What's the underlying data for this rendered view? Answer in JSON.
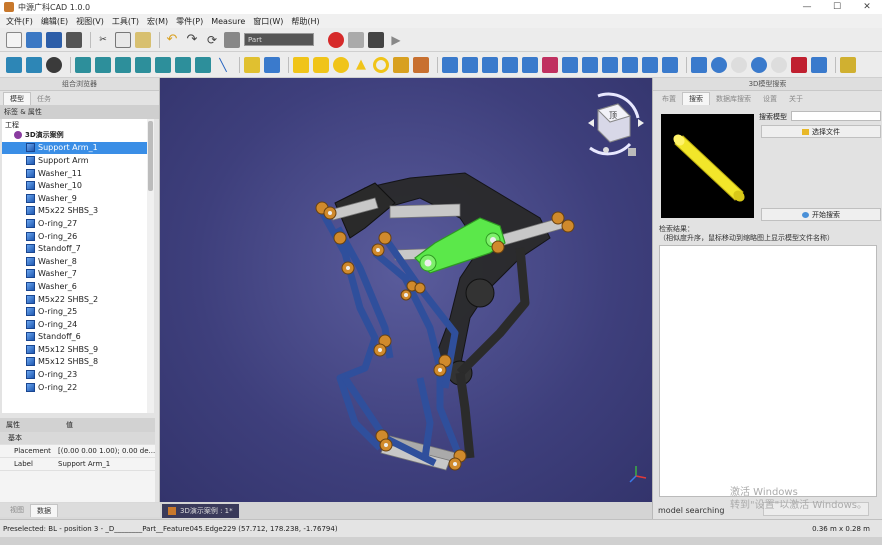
{
  "window": {
    "title": "中源广科CAD 1.0.0",
    "minimize": "—",
    "maximize": "☐",
    "close": "✕"
  },
  "menu": [
    "文件(F)",
    "编辑(E)",
    "视图(V)",
    "工具(T)",
    "宏(M)",
    "零件(P)",
    "Measure",
    "窗口(W)",
    "帮助(H)"
  ],
  "toolbar": {
    "part_combo": "Part"
  },
  "left_panel": {
    "header": "组合浏览器",
    "tabs": [
      "模型",
      "任务"
    ],
    "labels_section": "标签 & 属性",
    "project_label": "工程",
    "root_item": "3D演示案例",
    "tree_items": [
      "Support Arm_1",
      "Support Arm",
      "Washer_11",
      "Washer_10",
      "Washer_9",
      "M5x22 SHBS_3",
      "O-ring_27",
      "O-ring_26",
      "Standoff_7",
      "Washer_8",
      "Washer_7",
      "Washer_6",
      "M5x22 SHBS_2",
      "O-ring_25",
      "O-ring_24",
      "Standoff_6",
      "M5x12 SHBS_9",
      "M5x12 SHBS_8",
      "O-ring_23",
      "O-ring_22"
    ],
    "selected_index": 0,
    "property_header": [
      "属性",
      "值"
    ],
    "property_group": "基本",
    "properties": [
      {
        "key": "Placement",
        "value": "[(0.00 0.00 1.00); 0.00 de..."
      },
      {
        "key": "Label",
        "value": "Support Arm_1"
      }
    ],
    "bottom_tabs": [
      "视图",
      "数据"
    ]
  },
  "view3d": {
    "tab_label": "3D演示案例 : 1*",
    "navcube_face": "顶"
  },
  "right_panel": {
    "header": "3D模型搜索",
    "tabs": [
      "布置",
      "搜索",
      "数据库搜索",
      "设置",
      "关于"
    ],
    "search_label": "搜索模型",
    "select_file": "选择文件",
    "start_search": "开始搜索",
    "result_label_1": "检索结果：",
    "result_label_2": "（相似度升序，鼠标移动到缩略图上显示模型文件名称）",
    "status_label": "model searching"
  },
  "watermark": {
    "line1": "激活 Windows",
    "line2": "转到\"设置\"以激活 Windows。"
  },
  "statusbar": {
    "preselected": "Preselected: BL - position 3 - _D________Part__Feature045.Edge229 (57.712, 178.238, -1.76794)",
    "dims": "0.36 m x 0.28 m"
  },
  "colors": {
    "view_bg": "#3e3f7c",
    "selected_part": "#5be84a",
    "frame_blue": "#2f4f9c",
    "frame_dark": "#2a2a2a",
    "washer": "#d08a2c",
    "rod": "#c8c8c8"
  }
}
